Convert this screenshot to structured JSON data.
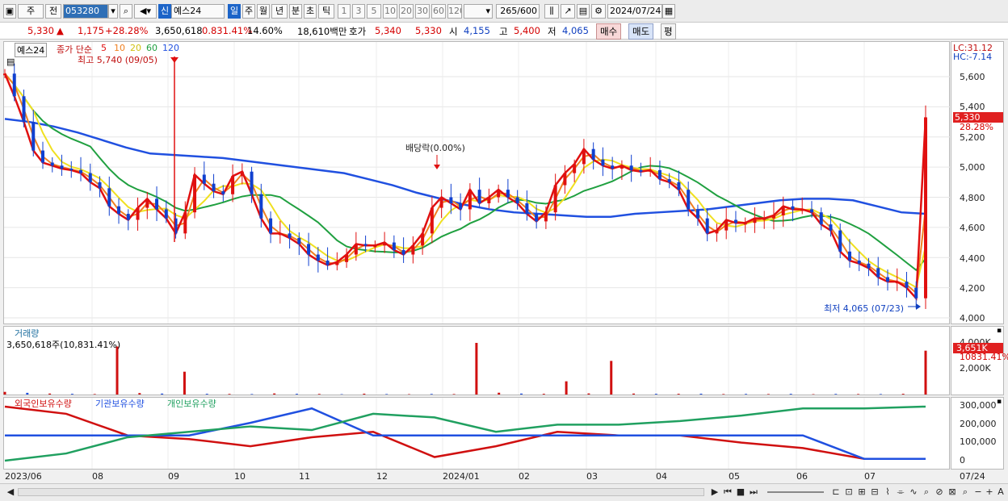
{
  "toolbar": {
    "type_label": "주",
    "prefix_label": "전",
    "code": "053280",
    "stock_badge": "신",
    "stock_name": "예스24",
    "periods": [
      "일",
      "주",
      "월",
      "년",
      "분",
      "초",
      "틱"
    ],
    "intervals": [
      "1",
      "3",
      "5",
      "10",
      "20",
      "30",
      "60",
      "120"
    ],
    "count": "265",
    "count_max": "/600",
    "date": "2024/07/24"
  },
  "quote": {
    "price": "5,330",
    "arrow": "▲",
    "change": "1,175",
    "change_pct": "+28.28%",
    "volume": "3,650,618",
    "vol_pct": "0.831.41%",
    "turnover": "14.60%",
    "amount": "18,610백만",
    "hoga_label": "호가",
    "hoga1": "5,340",
    "hoga2": "5,330",
    "open_label": "시",
    "open": "4,155",
    "high_label": "고",
    "high": "5,400",
    "low_label": "저",
    "low": "4,065",
    "buy": "매수",
    "sell": "매도",
    "eval": "평"
  },
  "price_chart": {
    "name": "예스24",
    "legend_title": "종가 단순",
    "ma": [
      "5",
      "10",
      "20",
      "60",
      "120"
    ],
    "ma_colors": [
      "#e01010",
      "#f08020",
      "#f0e020",
      "#20a040",
      "#2050e0"
    ],
    "high_note": "최고 5,740 (09/05)",
    "low_note": "최저 4,065 (07/23)",
    "dividend": "배당락(0.00%)",
    "lc": "LC:31.12",
    "hc": "HC:-7.14",
    "price_tag": "5,330",
    "pct_tag": "28.28%",
    "ylabels": [
      "5,600",
      "5,400",
      "5,200",
      "5,000",
      "4,800",
      "4,600",
      "4,400",
      "4,200",
      "4,000"
    ]
  },
  "volume_chart": {
    "title": "거래량",
    "current": "3,650,618주(10,831.41%)",
    "tag1": "3,651K",
    "tag2": "10831.41%",
    "ylabels": [
      "4,000K",
      "2,000K"
    ]
  },
  "holdings_chart": {
    "series": [
      "외국인보유수량",
      "기관보유수량",
      "개인보유수량"
    ],
    "colors": [
      "#d01010",
      "#2050e0",
      "#20a060"
    ],
    "ylabels": [
      "300,000",
      "200,000",
      "100,000",
      "0"
    ]
  },
  "xaxis": [
    "2023/06",
    "08",
    "09",
    "10",
    "11",
    "12",
    "2024/01",
    "02",
    "03",
    "04",
    "05",
    "06",
    "07"
  ],
  "xaxis_right": "07/24",
  "chart_data": {
    "type": "line",
    "title": "예스24",
    "ylim": [
      4000,
      5800
    ],
    "close": [
      5620,
      5470,
      5300,
      5110,
      5030,
      5010,
      4990,
      4980,
      4960,
      4900,
      4860,
      4740,
      4690,
      4650,
      4730,
      4790,
      4720,
      4660,
      4560,
      4700,
      4950,
      4890,
      4840,
      4820,
      4940,
      4970,
      4820,
      4660,
      4560,
      4560,
      4530,
      4490,
      4420,
      4380,
      4350,
      4370,
      4420,
      4490,
      4480,
      4480,
      4500,
      4450,
      4420,
      4480,
      4560,
      4730,
      4800,
      4760,
      4720,
      4850,
      4760,
      4800,
      4850,
      4800,
      4760,
      4690,
      4640,
      4700,
      4880,
      4960,
      5020,
      5120,
      5050,
      5010,
      4990,
      5010,
      4980,
      4970,
      4980,
      4920,
      4900,
      4850,
      4720,
      4660,
      4560,
      4580,
      4650,
      4630,
      4630,
      4660,
      4660,
      4680,
      4740,
      4720,
      4720,
      4700,
      4620,
      4580,
      4440,
      4380,
      4360,
      4330,
      4270,
      4240,
      4240,
      4200,
      4130,
      5330
    ],
    "ma120": [
      5320,
      5300,
      5270,
      5230,
      5180,
      5130,
      5090,
      5080,
      5070,
      5060,
      5040,
      5020,
      5000,
      4980,
      4960,
      4920,
      4880,
      4830,
      4790,
      4750,
      4720,
      4700,
      4690,
      4680,
      4670,
      4670,
      4690,
      4700,
      4710,
      4720,
      4740,
      4760,
      4780,
      4790,
      4790,
      4780,
      4740,
      4700,
      4690
    ],
    "volume": [
      220,
      140,
      80,
      60,
      40,
      4000,
      120,
      80,
      1900,
      60,
      50,
      40,
      90,
      60,
      50,
      30,
      70,
      40,
      30,
      50,
      40,
      4300,
      150,
      80,
      60,
      1100,
      90,
      2800,
      80,
      60,
      60,
      70,
      40,
      50,
      40,
      60,
      30,
      50,
      40,
      40,
      60,
      3650
    ],
    "holdings": {
      "외국인보유수량": [
        300000,
        260000,
        140000,
        120000,
        80000,
        130000,
        160000,
        20000,
        80000,
        160000,
        140000,
        140000,
        100000,
        70000,
        10000,
        10000
      ],
      "기관보유수량": [
        140000,
        140000,
        140000,
        140000,
        210000,
        290000,
        140000,
        140000,
        140000,
        140000,
        140000,
        140000,
        140000,
        140000,
        10000,
        10000
      ],
      "개인보유수량": [
        0,
        40000,
        130000,
        160000,
        190000,
        170000,
        260000,
        240000,
        160000,
        200000,
        200000,
        220000,
        250000,
        290000,
        290000,
        300000
      ]
    }
  }
}
